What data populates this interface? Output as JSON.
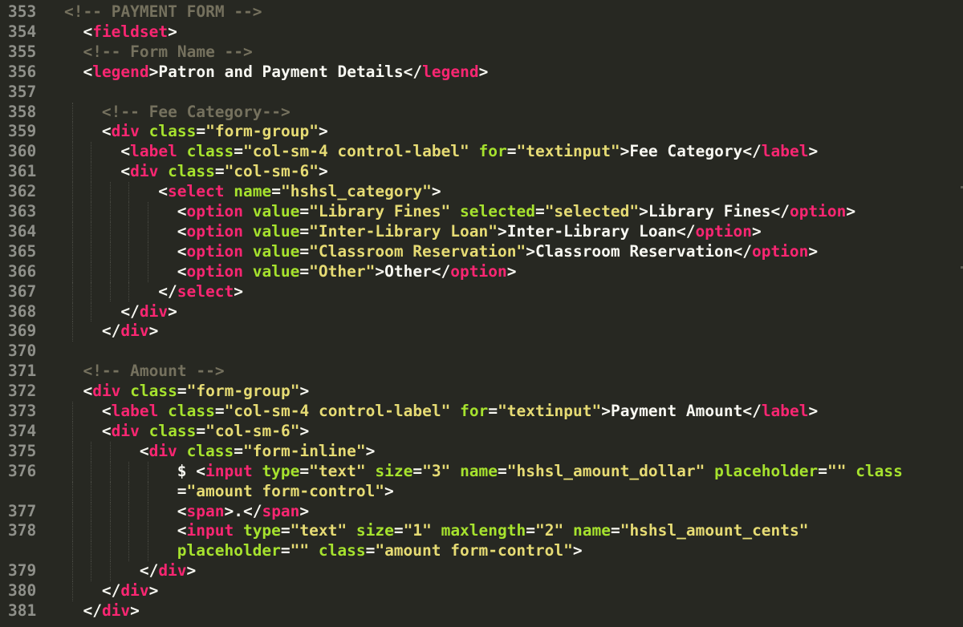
{
  "editor": {
    "theme": {
      "background": "#272822",
      "line_number": "#8f908a",
      "tag": "#f92672",
      "attribute": "#a6e22e",
      "string": "#e6db74",
      "comment": "#75715e",
      "text": "#f8f8f2"
    },
    "lines": [
      {
        "num": "353",
        "indent": 0,
        "tokens": [
          [
            "com",
            "<!-- PAYMENT FORM -->"
          ]
        ]
      },
      {
        "num": "354",
        "indent": 1,
        "tokens": [
          [
            "punct",
            "<"
          ],
          [
            "tag",
            "fieldset"
          ],
          [
            "punct",
            ">"
          ]
        ]
      },
      {
        "num": "355",
        "indent": 1,
        "tokens": [
          [
            "com",
            "<!-- Form Name -->"
          ]
        ]
      },
      {
        "num": "356",
        "indent": 1,
        "tokens": [
          [
            "punct",
            "<"
          ],
          [
            "tag",
            "legend"
          ],
          [
            "punct",
            ">"
          ],
          [
            "plain",
            "Patron and Payment Details"
          ],
          [
            "punct",
            "</"
          ],
          [
            "tag",
            "legend"
          ],
          [
            "punct",
            ">"
          ]
        ]
      },
      {
        "num": "357",
        "indent": 0,
        "tokens": []
      },
      {
        "num": "358",
        "indent": 2,
        "tokens": [
          [
            "com",
            "<!-- Fee Category-->"
          ]
        ]
      },
      {
        "num": "359",
        "indent": 2,
        "tokens": [
          [
            "punct",
            "<"
          ],
          [
            "tag",
            "div"
          ],
          [
            "plain",
            " "
          ],
          [
            "attr",
            "class"
          ],
          [
            "punct",
            "="
          ],
          [
            "str",
            "\"form-group\""
          ],
          [
            "punct",
            ">"
          ]
        ]
      },
      {
        "num": "360",
        "indent": 3,
        "tokens": [
          [
            "punct",
            "<"
          ],
          [
            "tag",
            "label"
          ],
          [
            "plain",
            " "
          ],
          [
            "attr",
            "class"
          ],
          [
            "punct",
            "="
          ],
          [
            "str",
            "\"col-sm-4 control-label\""
          ],
          [
            "plain",
            " "
          ],
          [
            "attr",
            "for"
          ],
          [
            "punct",
            "="
          ],
          [
            "str",
            "\"textinput\""
          ],
          [
            "punct",
            ">"
          ],
          [
            "plain",
            "Fee Category"
          ],
          [
            "punct",
            "</"
          ],
          [
            "tag",
            "label"
          ],
          [
            "punct",
            ">"
          ]
        ]
      },
      {
        "num": "361",
        "indent": 3,
        "tokens": [
          [
            "punct",
            "<"
          ],
          [
            "tag",
            "div"
          ],
          [
            "plain",
            " "
          ],
          [
            "attr",
            "class"
          ],
          [
            "punct",
            "="
          ],
          [
            "str",
            "\"col-sm-6\""
          ],
          [
            "punct",
            ">"
          ]
        ]
      },
      {
        "num": "362",
        "indent": 5,
        "tokens": [
          [
            "punct",
            "<"
          ],
          [
            "tag",
            "select"
          ],
          [
            "plain",
            " "
          ],
          [
            "attr",
            "name"
          ],
          [
            "punct",
            "="
          ],
          [
            "str",
            "\"hshsl_category\""
          ],
          [
            "punct",
            ">"
          ]
        ]
      },
      {
        "num": "363",
        "indent": 6,
        "tokens": [
          [
            "punct",
            "<"
          ],
          [
            "tag",
            "option"
          ],
          [
            "plain",
            " "
          ],
          [
            "attr",
            "value"
          ],
          [
            "punct",
            "="
          ],
          [
            "str",
            "\"Library Fines\""
          ],
          [
            "plain",
            " "
          ],
          [
            "attr",
            "selected"
          ],
          [
            "punct",
            "="
          ],
          [
            "str",
            "\"selected\""
          ],
          [
            "punct",
            ">"
          ],
          [
            "plain",
            "Library Fines"
          ],
          [
            "punct",
            "</"
          ],
          [
            "tag",
            "option"
          ],
          [
            "punct",
            ">"
          ]
        ]
      },
      {
        "num": "364",
        "indent": 6,
        "tokens": [
          [
            "punct",
            "<"
          ],
          [
            "tag",
            "option"
          ],
          [
            "plain",
            " "
          ],
          [
            "attr",
            "value"
          ],
          [
            "punct",
            "="
          ],
          [
            "str",
            "\"Inter-Library Loan\""
          ],
          [
            "punct",
            ">"
          ],
          [
            "plain",
            "Inter-Library Loan"
          ],
          [
            "punct",
            "</"
          ],
          [
            "tag",
            "option"
          ],
          [
            "punct",
            ">"
          ]
        ]
      },
      {
        "num": "365",
        "indent": 6,
        "tokens": [
          [
            "punct",
            "<"
          ],
          [
            "tag",
            "option"
          ],
          [
            "plain",
            " "
          ],
          [
            "attr",
            "value"
          ],
          [
            "punct",
            "="
          ],
          [
            "str",
            "\"Classroom Reservation\""
          ],
          [
            "punct",
            ">"
          ],
          [
            "plain",
            "Classroom Reservation"
          ],
          [
            "punct",
            "</"
          ],
          [
            "tag",
            "option"
          ],
          [
            "punct",
            ">"
          ]
        ]
      },
      {
        "num": "366",
        "indent": 6,
        "tokens": [
          [
            "punct",
            "<"
          ],
          [
            "tag",
            "option"
          ],
          [
            "plain",
            " "
          ],
          [
            "attr",
            "value"
          ],
          [
            "punct",
            "="
          ],
          [
            "str",
            "\"Other\""
          ],
          [
            "punct",
            ">"
          ],
          [
            "plain",
            "Other"
          ],
          [
            "punct",
            "</"
          ],
          [
            "tag",
            "option"
          ],
          [
            "punct",
            ">"
          ]
        ]
      },
      {
        "num": "367",
        "indent": 5,
        "tokens": [
          [
            "punct",
            "</"
          ],
          [
            "tag",
            "select"
          ],
          [
            "punct",
            ">"
          ]
        ]
      },
      {
        "num": "368",
        "indent": 3,
        "tokens": [
          [
            "punct",
            "</"
          ],
          [
            "tag",
            "div"
          ],
          [
            "punct",
            ">"
          ]
        ]
      },
      {
        "num": "369",
        "indent": 2,
        "tokens": [
          [
            "punct",
            "</"
          ],
          [
            "tag",
            "div"
          ],
          [
            "punct",
            ">"
          ]
        ]
      },
      {
        "num": "370",
        "indent": 0,
        "tokens": []
      },
      {
        "num": "371",
        "indent": 1,
        "tokens": [
          [
            "com",
            "<!-- Amount -->"
          ]
        ]
      },
      {
        "num": "372",
        "indent": 1,
        "tokens": [
          [
            "punct",
            "<"
          ],
          [
            "tag",
            "div"
          ],
          [
            "plain",
            " "
          ],
          [
            "attr",
            "class"
          ],
          [
            "punct",
            "="
          ],
          [
            "str",
            "\"form-group\""
          ],
          [
            "punct",
            ">"
          ]
        ]
      },
      {
        "num": "373",
        "indent": 2,
        "tokens": [
          [
            "punct",
            "<"
          ],
          [
            "tag",
            "label"
          ],
          [
            "plain",
            " "
          ],
          [
            "attr",
            "class"
          ],
          [
            "punct",
            "="
          ],
          [
            "str",
            "\"col-sm-4 control-label\""
          ],
          [
            "plain",
            " "
          ],
          [
            "attr",
            "for"
          ],
          [
            "punct",
            "="
          ],
          [
            "str",
            "\"textinput\""
          ],
          [
            "punct",
            ">"
          ],
          [
            "plain",
            "Payment Amount"
          ],
          [
            "punct",
            "</"
          ],
          [
            "tag",
            "label"
          ],
          [
            "punct",
            ">"
          ]
        ]
      },
      {
        "num": "374",
        "indent": 2,
        "tokens": [
          [
            "punct",
            "<"
          ],
          [
            "tag",
            "div"
          ],
          [
            "plain",
            " "
          ],
          [
            "attr",
            "class"
          ],
          [
            "punct",
            "="
          ],
          [
            "str",
            "\"col-sm-6\""
          ],
          [
            "punct",
            ">"
          ]
        ]
      },
      {
        "num": "375",
        "indent": 4,
        "tokens": [
          [
            "punct",
            "<"
          ],
          [
            "tag",
            "div"
          ],
          [
            "plain",
            " "
          ],
          [
            "attr",
            "class"
          ],
          [
            "punct",
            "="
          ],
          [
            "str",
            "\"form-inline\""
          ],
          [
            "punct",
            ">"
          ]
        ]
      },
      {
        "num": "376",
        "indent": 6,
        "tokens": [
          [
            "plain",
            "$ "
          ],
          [
            "punct",
            "<"
          ],
          [
            "tag",
            "input"
          ],
          [
            "plain",
            " "
          ],
          [
            "attr",
            "type"
          ],
          [
            "punct",
            "="
          ],
          [
            "str",
            "\"text\""
          ],
          [
            "plain",
            " "
          ],
          [
            "attr",
            "size"
          ],
          [
            "punct",
            "="
          ],
          [
            "str",
            "\"3\""
          ],
          [
            "plain",
            " "
          ],
          [
            "attr",
            "name"
          ],
          [
            "punct",
            "="
          ],
          [
            "str",
            "\"hshsl_amount_dollar\""
          ],
          [
            "plain",
            " "
          ],
          [
            "attr",
            "placeholder"
          ],
          [
            "punct",
            "="
          ],
          [
            "str",
            "\"\""
          ],
          [
            "plain",
            " "
          ],
          [
            "attr",
            "class"
          ]
        ]
      },
      {
        "num": "",
        "indent": 6,
        "tokens": [
          [
            "punct",
            "="
          ],
          [
            "str",
            "\"amount form-control\""
          ],
          [
            "punct",
            ">"
          ]
        ]
      },
      {
        "num": "377",
        "indent": 6,
        "tokens": [
          [
            "punct",
            "<"
          ],
          [
            "tag",
            "span"
          ],
          [
            "punct",
            ">"
          ],
          [
            "plain",
            "."
          ],
          [
            "punct",
            "</"
          ],
          [
            "tag",
            "span"
          ],
          [
            "punct",
            ">"
          ]
        ]
      },
      {
        "num": "378",
        "indent": 6,
        "tokens": [
          [
            "punct",
            "<"
          ],
          [
            "tag",
            "input"
          ],
          [
            "plain",
            " "
          ],
          [
            "attr",
            "type"
          ],
          [
            "punct",
            "="
          ],
          [
            "str",
            "\"text\""
          ],
          [
            "plain",
            " "
          ],
          [
            "attr",
            "size"
          ],
          [
            "punct",
            "="
          ],
          [
            "str",
            "\"1\""
          ],
          [
            "plain",
            " "
          ],
          [
            "attr",
            "maxlength"
          ],
          [
            "punct",
            "="
          ],
          [
            "str",
            "\"2\""
          ],
          [
            "plain",
            " "
          ],
          [
            "attr",
            "name"
          ],
          [
            "punct",
            "="
          ],
          [
            "str",
            "\"hshsl_amount_cents\""
          ]
        ]
      },
      {
        "num": "",
        "indent": 6,
        "tokens": [
          [
            "attr",
            "placeholder"
          ],
          [
            "punct",
            "="
          ],
          [
            "str",
            "\"\""
          ],
          [
            "plain",
            " "
          ],
          [
            "attr",
            "class"
          ],
          [
            "punct",
            "="
          ],
          [
            "str",
            "\"amount form-control\""
          ],
          [
            "punct",
            ">"
          ]
        ]
      },
      {
        "num": "379",
        "indent": 4,
        "tokens": [
          [
            "punct",
            "</"
          ],
          [
            "tag",
            "div"
          ],
          [
            "punct",
            ">"
          ]
        ]
      },
      {
        "num": "380",
        "indent": 2,
        "tokens": [
          [
            "punct",
            "</"
          ],
          [
            "tag",
            "div"
          ],
          [
            "punct",
            ">"
          ]
        ]
      },
      {
        "num": "381",
        "indent": 1,
        "tokens": [
          [
            "punct",
            "</"
          ],
          [
            "tag",
            "div"
          ],
          [
            "punct",
            ">"
          ]
        ]
      }
    ]
  }
}
